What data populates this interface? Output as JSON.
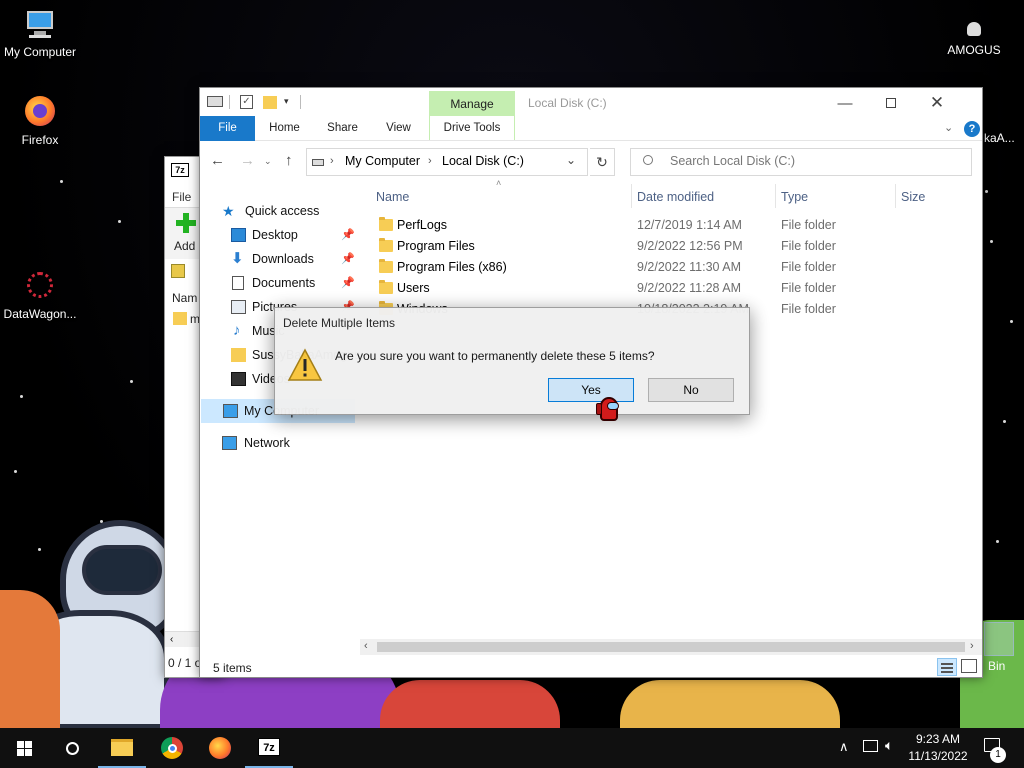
{
  "desktop": {
    "icons": [
      {
        "label": "My Computer"
      },
      {
        "label": "Firefox"
      },
      {
        "label": "DataWagon..."
      },
      {
        "label": "AMOGUS"
      }
    ],
    "partial_labels": {
      "right_edge": "kaA...",
      "recycle": "Bin"
    }
  },
  "sevenzip": {
    "menu_file": "File",
    "add_label": "Add",
    "column_name": "Nam",
    "row_partial": "m",
    "status": "0 / 1 o"
  },
  "explorer": {
    "title": "Local Disk (C:)",
    "contextual_group": "Manage",
    "tabs": {
      "file": "File",
      "home": "Home",
      "share": "Share",
      "view": "View",
      "drive_tools": "Drive Tools"
    },
    "breadcrumb": [
      "My Computer",
      "Local Disk (C:)"
    ],
    "search_placeholder": "Search Local Disk (C:)",
    "columns": {
      "name": "Name",
      "date": "Date modified",
      "type": "Type",
      "size": "Size"
    },
    "nav": {
      "quick_access": "Quick access",
      "desktop": "Desktop",
      "downloads": "Downloads",
      "documents": "Documents",
      "pictures": "Pictures",
      "music": "Music",
      "sussy": "SussyBakaAmogus",
      "videos": "Videos",
      "my_computer": "My Computer",
      "network": "Network"
    },
    "files": [
      {
        "name": "PerfLogs",
        "date": "12/7/2019 1:14 AM",
        "type": "File folder"
      },
      {
        "name": "Program Files",
        "date": "9/2/2022 12:56 PM",
        "type": "File folder"
      },
      {
        "name": "Program Files (x86)",
        "date": "9/2/2022 11:30 AM",
        "type": "File folder"
      },
      {
        "name": "Users",
        "date": "9/2/2022 11:28 AM",
        "type": "File folder"
      },
      {
        "name": "Windows",
        "date": "10/18/2022 2:19 AM",
        "type": "File folder"
      }
    ],
    "status": "5 items"
  },
  "dialog": {
    "title": "Delete Multiple Items",
    "message": "Are you sure you want to permanently delete these 5 items?",
    "yes": "Yes",
    "no": "No"
  },
  "taskbar": {
    "time": "9:23 AM",
    "date": "11/13/2022",
    "notification_count": "1"
  },
  "colors": {
    "accent": "#1979ca",
    "manage_bg": "#c5eeb1",
    "taskbar": "#101010",
    "folder": "#f7cd55"
  }
}
